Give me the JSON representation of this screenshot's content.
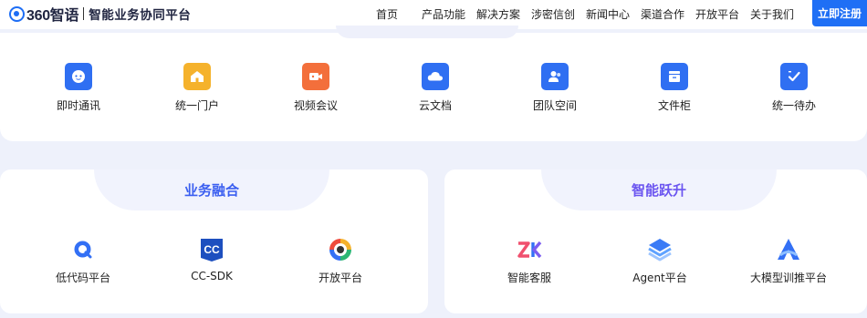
{
  "brand": {
    "name": "360智语",
    "tagline": "智能业务协同平台"
  },
  "nav": [
    "首页",
    "产品功能",
    "解决方案",
    "涉密信创",
    "新闻中心",
    "渠道合作",
    "开放平台",
    "关于我们"
  ],
  "cta_label": "立即注册",
  "tools": [
    {
      "label": "即时通讯",
      "icon": "chat-bubble-icon",
      "color": "#2f6ff2"
    },
    {
      "label": "统一门户",
      "icon": "home-icon",
      "color": "#f5b22c"
    },
    {
      "label": "视频会议",
      "icon": "video-camera-icon",
      "color": "#f36f3b"
    },
    {
      "label": "云文档",
      "icon": "cloud-icon",
      "color": "#2f6ff2"
    },
    {
      "label": "团队空间",
      "icon": "team-icon",
      "color": "#2f6ff2"
    },
    {
      "label": "文件柜",
      "icon": "cabinet-icon",
      "color": "#2f6ff2"
    },
    {
      "label": "统一待办",
      "icon": "checklist-icon",
      "color": "#2f6ff2"
    }
  ],
  "panels": {
    "left": {
      "title": "业务融合",
      "items": [
        {
          "label": "低代码平台",
          "icon": "low-code-icon"
        },
        {
          "label": "CC-SDK",
          "icon": "cc-sdk-icon"
        },
        {
          "label": "开放平台",
          "icon": "open-platform-icon"
        }
      ]
    },
    "right": {
      "title": "智能跃升",
      "items": [
        {
          "label": "智能客服",
          "icon": "zk-logo-icon"
        },
        {
          "label": "Agent平台",
          "icon": "agent-cube-icon"
        },
        {
          "label": "大模型训推平台",
          "icon": "model-training-icon"
        }
      ]
    }
  },
  "colors": {
    "accent": "#1f6ff5",
    "title_gradient_start": "#3b6ff0",
    "title_gradient_end": "#8a4ff0"
  }
}
